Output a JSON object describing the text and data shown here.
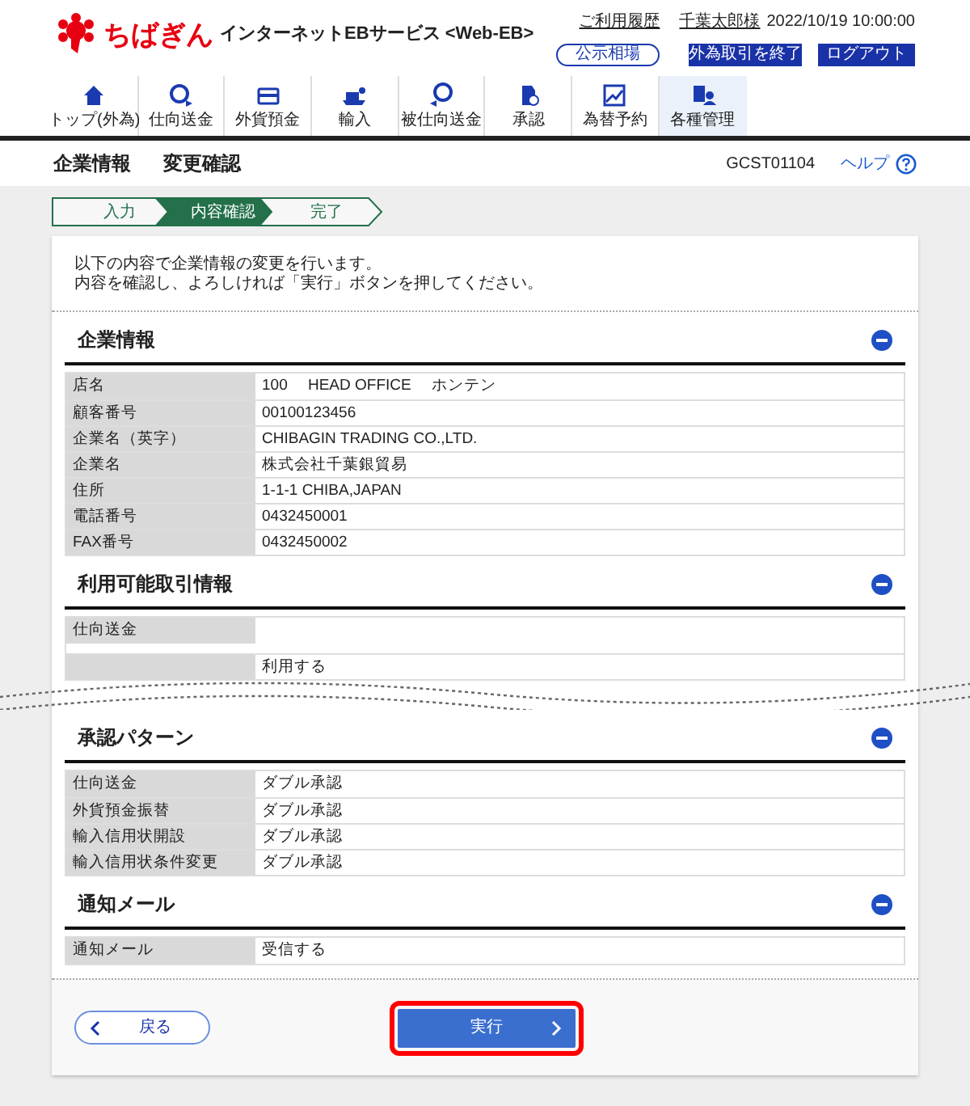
{
  "header": {
    "logo_text": "ちばぎん",
    "service_name": "インターネットEBサービス <Web-EB>",
    "history_link": "ご利用履歴",
    "user": "千葉太郎様",
    "datetime": "2022/10/19 10:00:00",
    "buttons": [
      {
        "label": "公示相場",
        "kind": "outline"
      },
      {
        "label": "外為取引を終了",
        "kind": "solid"
      },
      {
        "label": "ログアウト",
        "kind": "solid"
      }
    ]
  },
  "nav": {
    "items": [
      {
        "label": "トップ(外為)",
        "selected": false
      },
      {
        "label": "仕向送金",
        "selected": false
      },
      {
        "label": "外貨預金",
        "selected": false
      },
      {
        "label": "輸入",
        "selected": false
      },
      {
        "label": "被仕向送金",
        "selected": false
      },
      {
        "label": "承認",
        "selected": false
      },
      {
        "label": "為替予約",
        "selected": false
      },
      {
        "label": "各種管理",
        "selected": true
      }
    ]
  },
  "page_title": {
    "parts": [
      "企業情報",
      "変更確認"
    ],
    "screen_id": "GCST01104",
    "help": "ヘルプ"
  },
  "steps": [
    {
      "label": "入力",
      "selected": false
    },
    {
      "label": "内容確認",
      "selected": true
    },
    {
      "label": "完了",
      "selected": false
    }
  ],
  "message": [
    "以下の内容で企業情報の変更を行います。",
    "内容を確認し、よろしければ「実行」ボタンを押してください。"
  ],
  "sections": [
    {
      "title": "企業情報",
      "expanded": true,
      "rows": [
        {
          "label": "店名",
          "value": "100　 HEAD OFFICE　 ホンテン"
        },
        {
          "label": "顧客番号",
          "value": "00100123456"
        },
        {
          "label": "企業名（英字）",
          "value": "CHIBAGIN TRADING CO.,LTD."
        },
        {
          "label": "企業名",
          "value": "株式会社千葉銀貿易"
        },
        {
          "label": "住所",
          "value": "1-1-1 CHIBA,JAPAN"
        },
        {
          "label": "電話番号",
          "value": "0432450001"
        },
        {
          "label": "FAX番号",
          "value": "0432450002"
        }
      ]
    },
    {
      "title": "利用可能取引情報",
      "expanded": true,
      "cut": true,
      "rows": [
        {
          "label": "仕向送金"
        },
        {
          "value": "利用する"
        }
      ]
    },
    {
      "title": "承認パターン",
      "expanded": true,
      "rows": [
        {
          "label": "仕向送金",
          "value": "ダブル承認"
        },
        {
          "label": "外貨預金振替",
          "value": "ダブル承認"
        },
        {
          "label": "輸入信用状開設",
          "value": "ダブル承認"
        },
        {
          "label": "輸入信用状条件変更",
          "value": "ダブル承認"
        }
      ]
    },
    {
      "title": "通知メール",
      "expanded": true,
      "rows": [
        {
          "label": "通知メール",
          "value": "受信する"
        }
      ]
    }
  ],
  "footer": {
    "back": {
      "label": "戻る"
    },
    "execute": {
      "label": "実行",
      "highlighted": true
    }
  }
}
